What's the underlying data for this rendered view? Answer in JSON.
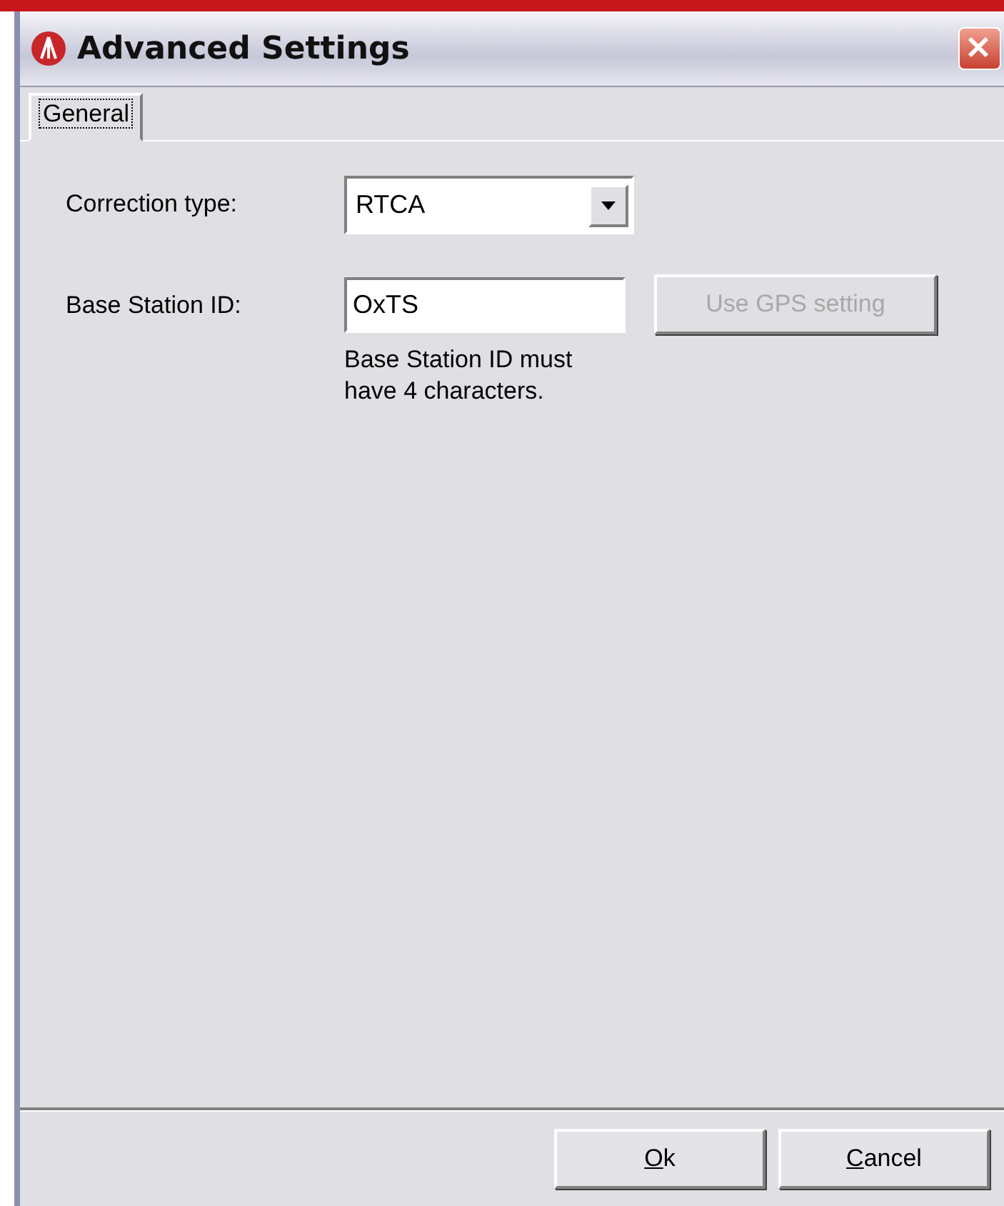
{
  "window": {
    "title": "Advanced Settings"
  },
  "tabs": [
    {
      "label": "General",
      "selected": true
    }
  ],
  "fields": [
    {
      "kind": "combo",
      "label": "Correction type:",
      "value": "RTCA"
    },
    {
      "kind": "text",
      "label": "Base Station ID:",
      "value": "OxTS",
      "button": {
        "label": "Use GPS setting",
        "disabled": true
      },
      "hint": "Base Station ID must have 4 characters."
    }
  ],
  "buttons": [
    {
      "label": "Ok",
      "disabled": false
    },
    {
      "label": "Cancel",
      "disabled": false
    }
  ]
}
